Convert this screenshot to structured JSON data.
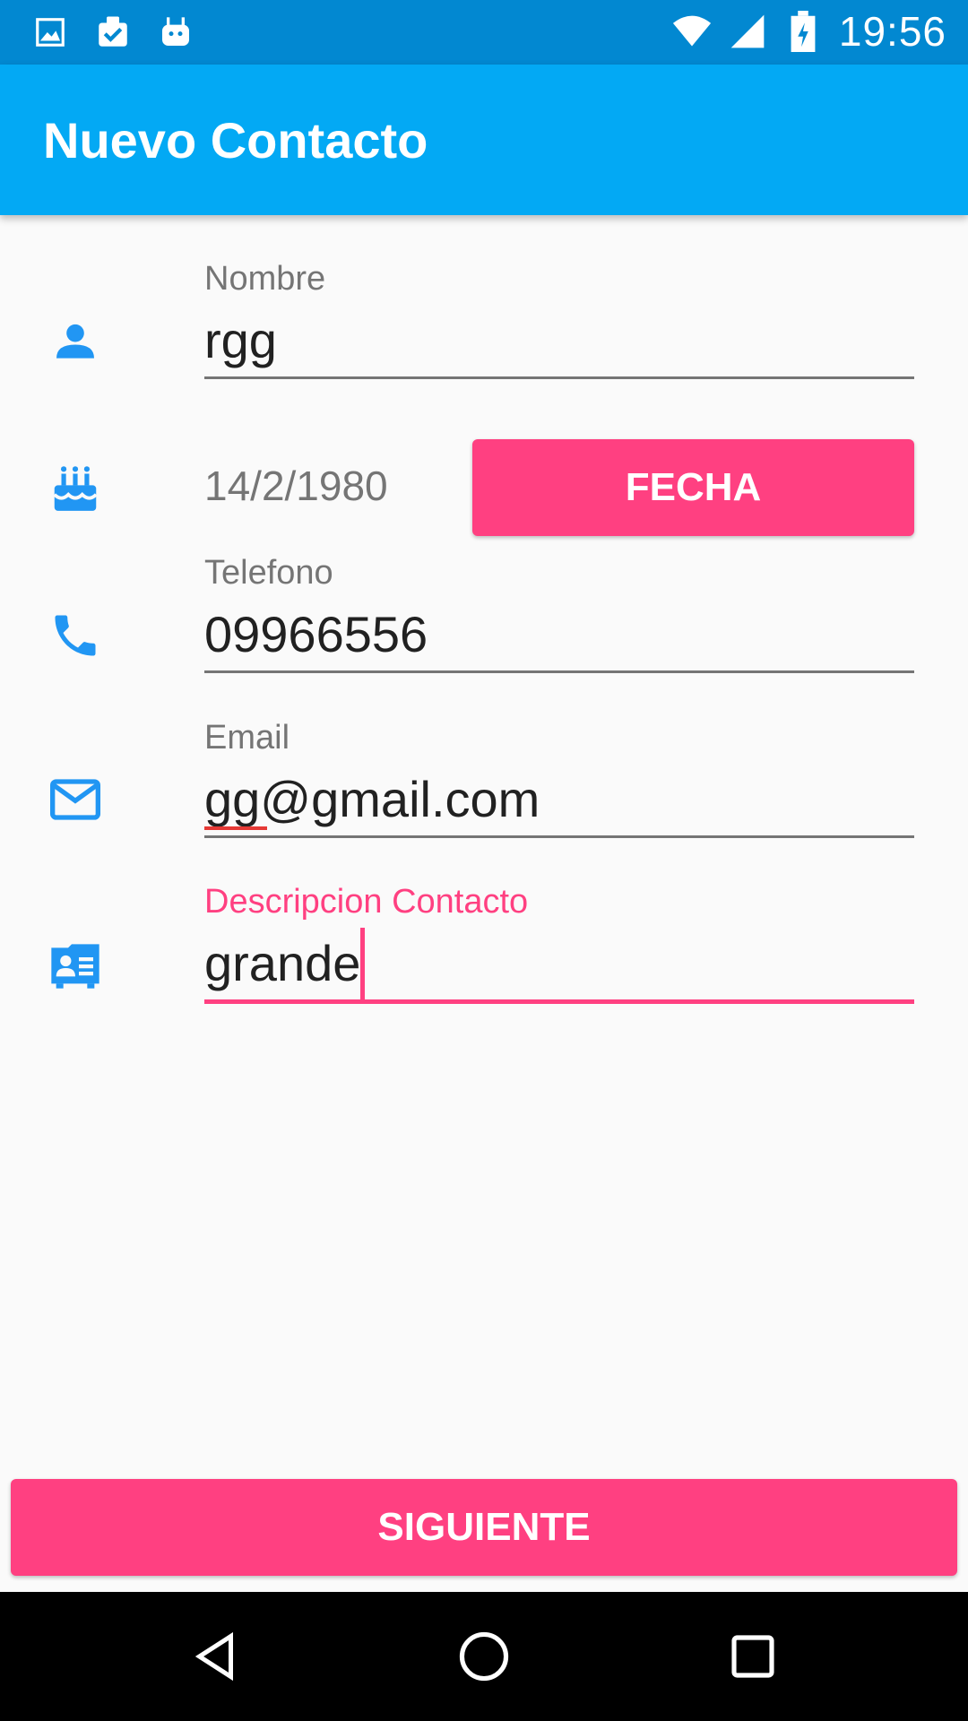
{
  "status_bar": {
    "time": "19:56",
    "left_icons": [
      "image-icon",
      "clipboard-check-icon",
      "android-icon"
    ],
    "right_icons": [
      "wifi-icon",
      "signal-icon",
      "battery-charging-icon"
    ]
  },
  "app_bar": {
    "title": "Nuevo Contacto",
    "color": "#03a9f4"
  },
  "form": {
    "nombre": {
      "label": "Nombre",
      "value": "rgg",
      "icon": "person-icon"
    },
    "fecha": {
      "value": "14/2/1980",
      "button_label": "FECHA",
      "icon": "cake-icon"
    },
    "telefono": {
      "label": "Telefono",
      "value": "09966556",
      "icon": "phone-icon"
    },
    "email": {
      "label": "Email",
      "value": "gg@gmail.com",
      "icon": "mail-icon"
    },
    "descripcion": {
      "label": "Descripcion Contacto",
      "value": "grande",
      "icon": "contact-card-icon"
    }
  },
  "actions": {
    "next_label": "SIGUIENTE",
    "accent": "#ff4081"
  },
  "nav_bar": {
    "buttons": [
      "back-icon",
      "home-icon",
      "recents-icon"
    ]
  }
}
